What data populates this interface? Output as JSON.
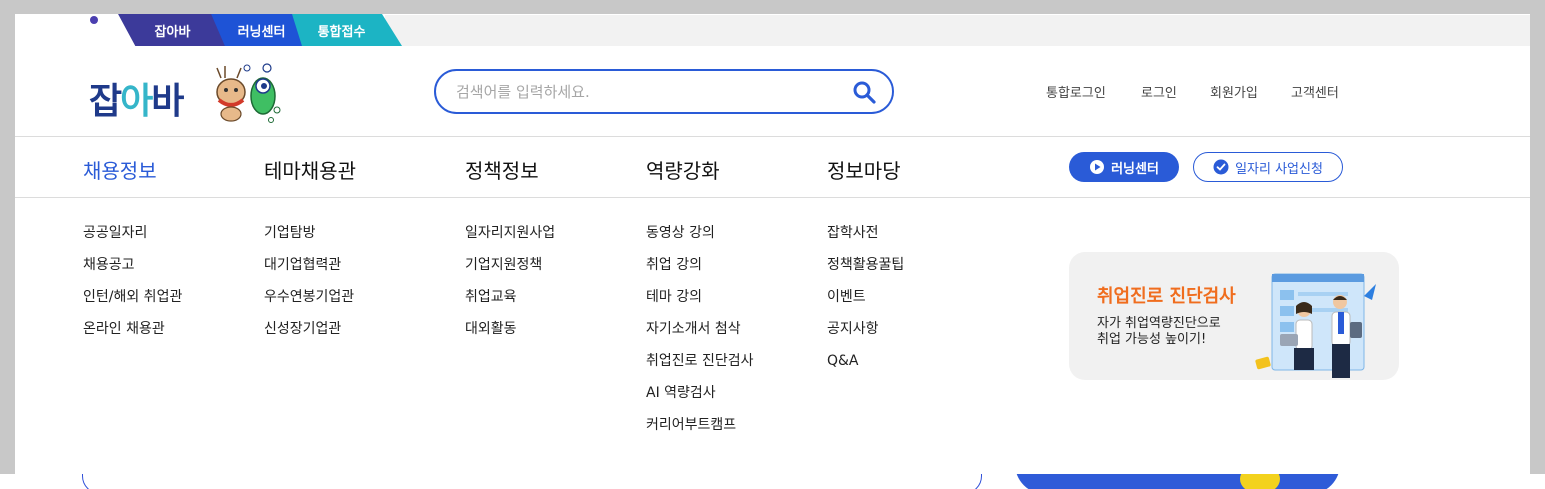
{
  "top_tabs": [
    {
      "label": "잡아바"
    },
    {
      "label": "러닝센터"
    },
    {
      "label": "통합접수"
    }
  ],
  "logo": {
    "text_part1": "잡",
    "text_part2": "아",
    "text_part3": "바"
  },
  "search": {
    "placeholder": "검색어를 입력하세요.",
    "value": ""
  },
  "utility_links": [
    "통합로그인",
    "로그인",
    "회원가입",
    "고객센터"
  ],
  "gnb": [
    {
      "label": "채용정보",
      "active": true,
      "items": [
        "공공일자리",
        "채용공고",
        "인턴/해외 취업관",
        "온라인 채용관"
      ]
    },
    {
      "label": "테마채용관",
      "active": false,
      "items": [
        "기업탐방",
        "대기업협력관",
        "우수연봉기업관",
        "신성장기업관"
      ]
    },
    {
      "label": "정책정보",
      "active": false,
      "items": [
        "일자리지원사업",
        "기업지원정책",
        "취업교육",
        "대외활동"
      ]
    },
    {
      "label": "역량강화",
      "active": false,
      "items": [
        "동영상 강의",
        "취업 강의",
        "테마 강의",
        "자기소개서 첨삭",
        "취업진로 진단검사",
        "AI 역량검사",
        "커리어부트캠프"
      ]
    },
    {
      "label": "정보마당",
      "active": false,
      "items": [
        "잡학사전",
        "정책활용꿀팁",
        "이벤트",
        "공지사항",
        "Q&A"
      ]
    }
  ],
  "buttons": {
    "learning_center": "러닝센터",
    "job_apply": "일자리 사업신청"
  },
  "promo": {
    "title": "취업진로 진단검사",
    "desc_line1": "자가 취업역량진단으로",
    "desc_line2": "취업 가능성 높이기!"
  },
  "colors": {
    "accent": "#2a5bd7",
    "promo_title": "#f06d1e",
    "tab1": "#3c3a9a",
    "tab2": "#1e53d6",
    "tab3": "#1cb4c4"
  }
}
